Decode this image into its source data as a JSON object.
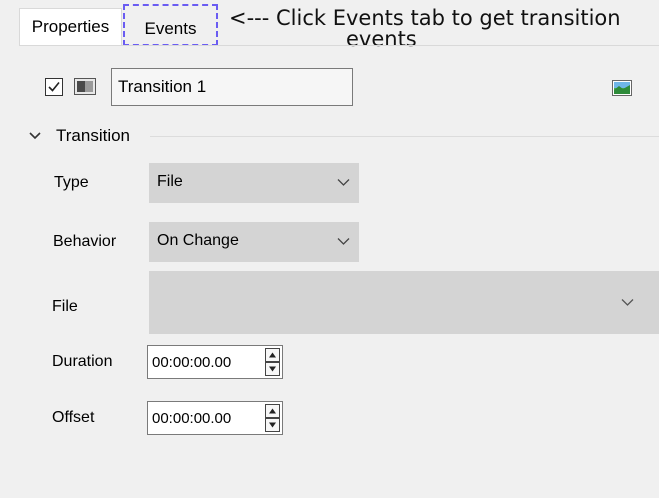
{
  "tabs": {
    "properties": "Properties",
    "events": "Events"
  },
  "annotation": {
    "line1": "<--- Click Events tab to get transition",
    "line2": "events"
  },
  "header": {
    "enabled": true,
    "name": "Transition 1",
    "icons": [
      "checkbox-checked-icon",
      "layer-icon",
      "image-icon"
    ]
  },
  "section": {
    "title": "Transition",
    "icon": "chevron-down-icon"
  },
  "fields": {
    "type": {
      "label": "Type",
      "value": "File"
    },
    "behavior": {
      "label": "Behavior",
      "value": "On Change"
    },
    "file": {
      "label": "File",
      "value": ""
    },
    "duration": {
      "label": "Duration",
      "value": "00:00:00.00"
    },
    "offset": {
      "label": "Offset",
      "value": "00:00:00.00"
    }
  },
  "colors": {
    "panel_bg": "#f0f0f0",
    "select_bg": "#d4d4d4",
    "highlight_dash": "#6a5cf2"
  }
}
